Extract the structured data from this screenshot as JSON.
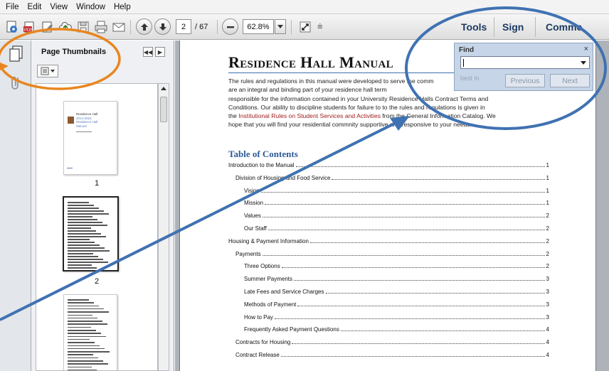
{
  "menu": [
    "File",
    "Edit",
    "View",
    "Window",
    "Help"
  ],
  "toolbar": {
    "page_current": "2",
    "page_total": "/ 67",
    "zoom": "62.8%",
    "tools_label": "Tools",
    "sign_label": "Sign",
    "comment_label": "Comme"
  },
  "thumbnails_panel": {
    "title": "Page Thumbnails",
    "thumb_cover_lines": [
      "Residence Hall",
      "2014-2015",
      "Residence Hall",
      "Manual"
    ],
    "pages": [
      "1",
      "2"
    ]
  },
  "document": {
    "title": "Residence Hall Manual",
    "intro_part1": "The rules and regulations in this manual were developed to serve the comm",
    "intro_part1b": "are an integral and binding part of your residence hall term",
    "intro_part1c": "responsible for the information contained in your University",
    "intro_part1d": "Residence Halls Contract Terms and",
    "intro_part1e": "Conditions. Our ability to discipline students for failure to",
    "intro_part1f": "to the rules and regulations is given in",
    "intro_part1g": "the ",
    "intro_red1": "Institutional Rules on Student Services and Activities",
    "intro_part1h": " from the General Information Catalog. We",
    "intro_part1i": "hope that you will find your residential comm",
    "intro_part1j": "nity supportive and responsive to your needs.",
    "toc_title": "Table of Contents",
    "toc": [
      {
        "label": "Introduction to the Manual",
        "page": "1",
        "indent": 0
      },
      {
        "label": "Division of Housing and Food Service",
        "page": "1",
        "indent": 1
      },
      {
        "label": "Vision",
        "page": "1",
        "indent": 2
      },
      {
        "label": "Mission",
        "page": "1",
        "indent": 2
      },
      {
        "label": "Values",
        "page": "2",
        "indent": 2
      },
      {
        "label": "Our Staff",
        "page": "2",
        "indent": 2
      },
      {
        "label": "Housing & Payment Information",
        "page": "2",
        "indent": 0
      },
      {
        "label": "Payments",
        "page": "2",
        "indent": 1
      },
      {
        "label": "Three Options",
        "page": "2",
        "indent": 2
      },
      {
        "label": "Summer Payments",
        "page": "3",
        "indent": 2
      },
      {
        "label": "Late Fees and Service Charges",
        "page": "3",
        "indent": 2
      },
      {
        "label": "Methods of Payment",
        "page": "3",
        "indent": 2
      },
      {
        "label": "How to Pay",
        "page": "3",
        "indent": 2
      },
      {
        "label": "Frequently Asked Payment Questions",
        "page": "4",
        "indent": 2
      },
      {
        "label": "Contracts for Housing",
        "page": "4",
        "indent": 1
      },
      {
        "label": "Contract Release",
        "page": "4",
        "indent": 1
      }
    ]
  },
  "find": {
    "title": "Find",
    "close": "×",
    "ghost": "best in",
    "previous": "Previous",
    "next": "Next"
  },
  "colors": {
    "annotation_orange": "#e8861f",
    "annotation_blue": "#3f72b2"
  }
}
